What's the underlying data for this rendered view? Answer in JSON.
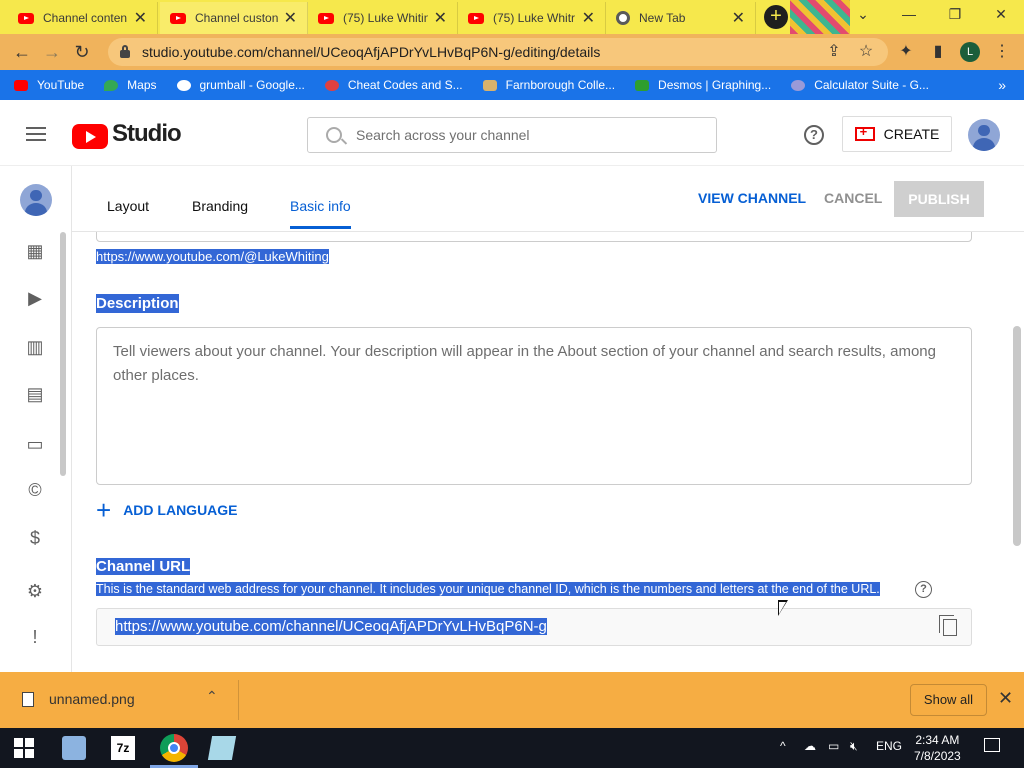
{
  "browser": {
    "tabs": [
      {
        "title": "Channel conten",
        "icon": "youtube-icon",
        "active": false
      },
      {
        "title": "Channel custon",
        "icon": "youtube-icon",
        "active": true
      },
      {
        "title": "(75) Luke Whitin",
        "icon": "youtube-icon",
        "active": false
      },
      {
        "title": "(75) Luke Whitr",
        "icon": "youtube-icon",
        "active": false
      },
      {
        "title": "New Tab",
        "icon": "chrome-icon",
        "active": false
      }
    ],
    "url": "studio.youtube.com/channel/UCeoqAfjAPDrYvLHvBqP6N-g/editing/details",
    "profile_initial": "L",
    "bookmarks": [
      {
        "label": "YouTube",
        "color": "#ff0000"
      },
      {
        "label": "Maps",
        "color": "#34a853"
      },
      {
        "label": "grumball - Google...",
        "color": "#ffffff"
      },
      {
        "label": "Cheat Codes and S...",
        "color": "#e04040"
      },
      {
        "label": "Farnborough Colle...",
        "color": "#d9b26b"
      },
      {
        "label": "Desmos | Graphing...",
        "color": "#2e9e2e"
      },
      {
        "label": "Calculator Suite - G...",
        "color": "#9a9ad8"
      }
    ],
    "more_bookmarks": "»"
  },
  "studio": {
    "brand": "Studio",
    "search_placeholder": "Search across your channel",
    "help": "?",
    "create_label": "CREATE",
    "tabs": [
      "Layout",
      "Branding",
      "Basic info"
    ],
    "selected_tab": "Basic info",
    "view_channel": "VIEW CHANNEL",
    "cancel": "CANCEL",
    "publish": "PUBLISH"
  },
  "content": {
    "handle_url": "https://www.youtube.com/@LukeWhiting",
    "description_title": "Description",
    "description_placeholder": "Tell viewers about your channel. Your description will appear in the About section of your channel and search results, among other places.",
    "add_language": "ADD LANGUAGE",
    "channel_url_title": "Channel URL",
    "channel_url_desc": "This is the standard web address for your channel. It includes your unique channel ID, which is the numbers and letters at the end of the URL.",
    "channel_url_help": "?",
    "channel_url_value": "https://www.youtube.com/channel/UCeoqAfjAPDrYvLHvBqP6N-g"
  },
  "download_bar": {
    "filename": "unnamed.png",
    "show_all": "Show all"
  },
  "taskbar": {
    "language": "ENG",
    "time": "2:34 AM",
    "date": "7/8/2023",
    "app_7z_label": "7z"
  },
  "colors": {
    "accent_blue": "#065fd4",
    "selection": "#3367d6",
    "youtube_red": "#ff0000",
    "tabstrip": "#f6e84c",
    "addressbar": "#f0b35c",
    "bookmarksbar": "#1a73e8",
    "download_bar": "#f6ad43"
  }
}
